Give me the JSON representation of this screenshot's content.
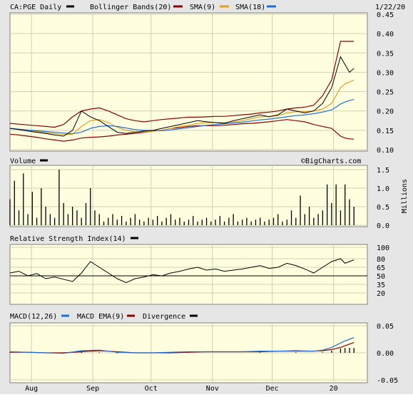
{
  "colors": {
    "frame_bg": "#e6e6e6",
    "panel_bg": "#ffffe0",
    "grid": "#cfcfb8",
    "price": "#000000",
    "bollinger": "#8b0000",
    "sma9": "#e0a020",
    "sma18": "#1f6fd8",
    "volume": "#000000",
    "rsi": "#000000",
    "macd": "#1f6fd8",
    "macd_ema": "#8b0000",
    "divergence": "#000000"
  },
  "header": {
    "date": "1/22/20",
    "legend": [
      {
        "label": "CA:PGE Daily",
        "color": "#000000"
      },
      {
        "label": "Bollinger Bands(20)",
        "color": "#8b0000"
      },
      {
        "label": "SMA(9)",
        "color": "#8b0000"
      },
      {
        "label": "SMA(18)",
        "color": "#e0a020"
      }
    ],
    "extra_swatch_color": "#1f6fd8"
  },
  "watermark": "©BigCharts.com",
  "chart_data": [
    {
      "type": "line",
      "panel": "price",
      "ticks": [
        0.1,
        0.15,
        0.2,
        0.25,
        0.3,
        0.35,
        0.4,
        0.45
      ],
      "tick_labels": [
        "0.10",
        "0.15",
        "0.20",
        "0.25",
        "0.30",
        "0.35",
        "0.40",
        "0.45"
      ],
      "ylim": [
        0.1,
        0.45
      ],
      "grid": true,
      "x": [
        0,
        4,
        8,
        12,
        16,
        20,
        24,
        28,
        32,
        36,
        40,
        44,
        48,
        52,
        56,
        60,
        64,
        68,
        72,
        76,
        80,
        84,
        88,
        92,
        96,
        100,
        104,
        108,
        112,
        116,
        120,
        124,
        128,
        132,
        136,
        140,
        144,
        146,
        148,
        150,
        152,
        154
      ],
      "close": [
        0.155,
        0.152,
        0.148,
        0.145,
        0.142,
        0.138,
        0.135,
        0.15,
        0.2,
        0.185,
        0.175,
        0.16,
        0.145,
        0.142,
        0.145,
        0.148,
        0.15,
        0.155,
        0.16,
        0.165,
        0.17,
        0.175,
        0.172,
        0.17,
        0.168,
        0.175,
        0.18,
        0.185,
        0.19,
        0.185,
        0.19,
        0.205,
        0.2,
        0.195,
        0.2,
        0.22,
        0.26,
        0.3,
        0.34,
        0.32,
        0.3,
        0.31
      ],
      "bb_upper": [
        0.168,
        0.166,
        0.164,
        0.162,
        0.16,
        0.158,
        0.165,
        0.185,
        0.2,
        0.205,
        0.208,
        0.2,
        0.19,
        0.18,
        0.175,
        0.172,
        0.175,
        0.178,
        0.18,
        0.182,
        0.184,
        0.184,
        0.185,
        0.186,
        0.186,
        0.188,
        0.19,
        0.192,
        0.195,
        0.197,
        0.2,
        0.205,
        0.208,
        0.21,
        0.215,
        0.24,
        0.28,
        0.33,
        0.38,
        0.38,
        0.38,
        0.38
      ],
      "bb_lower": [
        0.14,
        0.138,
        0.135,
        0.132,
        0.128,
        0.125,
        0.122,
        0.125,
        0.13,
        0.132,
        0.133,
        0.135,
        0.138,
        0.14,
        0.142,
        0.145,
        0.148,
        0.15,
        0.155,
        0.157,
        0.16,
        0.162,
        0.162,
        0.162,
        0.163,
        0.165,
        0.167,
        0.168,
        0.17,
        0.172,
        0.175,
        0.178,
        0.175,
        0.172,
        0.165,
        0.16,
        0.155,
        0.145,
        0.135,
        0.13,
        0.128,
        0.127
      ],
      "sma9": [
        0.155,
        0.152,
        0.15,
        0.147,
        0.144,
        0.141,
        0.139,
        0.14,
        0.16,
        0.175,
        0.178,
        0.17,
        0.158,
        0.15,
        0.146,
        0.146,
        0.148,
        0.15,
        0.155,
        0.16,
        0.163,
        0.168,
        0.17,
        0.17,
        0.17,
        0.172,
        0.175,
        0.18,
        0.185,
        0.186,
        0.188,
        0.195,
        0.198,
        0.198,
        0.2,
        0.205,
        0.22,
        0.24,
        0.26,
        0.27,
        0.275,
        0.28
      ],
      "sma18": [
        0.155,
        0.153,
        0.151,
        0.149,
        0.147,
        0.145,
        0.143,
        0.141,
        0.145,
        0.155,
        0.16,
        0.162,
        0.16,
        0.156,
        0.152,
        0.15,
        0.149,
        0.149,
        0.151,
        0.154,
        0.157,
        0.16,
        0.163,
        0.165,
        0.167,
        0.169,
        0.171,
        0.174,
        0.177,
        0.179,
        0.182,
        0.185,
        0.188,
        0.19,
        0.193,
        0.197,
        0.203,
        0.21,
        0.218,
        0.223,
        0.227,
        0.23
      ]
    },
    {
      "type": "bar",
      "panel": "volume",
      "ticks": [
        0.0,
        0.5,
        1.0,
        1.5
      ],
      "tick_labels": [
        "0.0",
        "0.5",
        "1.0",
        "1.5"
      ],
      "ylim": [
        0,
        1.5
      ],
      "ylabel": "Millions",
      "title": "Volume",
      "grid": true,
      "x": [
        0,
        2,
        4,
        6,
        8,
        10,
        12,
        14,
        16,
        18,
        20,
        22,
        24,
        26,
        28,
        30,
        32,
        34,
        36,
        38,
        40,
        42,
        44,
        46,
        48,
        50,
        52,
        54,
        56,
        58,
        60,
        62,
        64,
        66,
        68,
        70,
        72,
        74,
        76,
        78,
        80,
        82,
        84,
        86,
        88,
        90,
        92,
        94,
        96,
        98,
        100,
        102,
        104,
        106,
        108,
        110,
        112,
        114,
        116,
        118,
        120,
        122,
        124,
        126,
        128,
        130,
        132,
        134,
        136,
        138,
        140,
        142,
        144,
        146,
        148,
        150,
        152,
        154
      ],
      "values": [
        0.7,
        1.2,
        0.4,
        1.4,
        0.3,
        0.9,
        0.2,
        1.0,
        0.5,
        0.3,
        0.2,
        1.5,
        0.6,
        0.3,
        0.5,
        0.4,
        0.2,
        0.6,
        1.0,
        0.4,
        0.3,
        0.1,
        0.2,
        0.3,
        0.15,
        0.25,
        0.1,
        0.2,
        0.3,
        0.15,
        0.1,
        0.2,
        0.15,
        0.25,
        0.1,
        0.2,
        0.3,
        0.15,
        0.2,
        0.1,
        0.15,
        0.25,
        0.1,
        0.15,
        0.2,
        0.1,
        0.15,
        0.25,
        0.1,
        0.2,
        0.3,
        0.1,
        0.15,
        0.2,
        0.1,
        0.15,
        0.2,
        0.1,
        0.15,
        0.2,
        0.3,
        0.1,
        0.15,
        0.4,
        0.2,
        0.8,
        0.3,
        0.5,
        0.2,
        0.3,
        0.4,
        1.1,
        0.6,
        1.1,
        0.4,
        1.1,
        0.7,
        0.5
      ]
    },
    {
      "type": "line",
      "panel": "rsi",
      "title": "Relative Strength Index(14)",
      "ticks": [
        20,
        35,
        50,
        65,
        80,
        100
      ],
      "tick_labels": [
        "20",
        "35",
        "50",
        "65",
        "80",
        "100"
      ],
      "ylim": [
        0,
        100
      ],
      "reference_line": 50,
      "grid": true,
      "x": [
        0,
        4,
        8,
        12,
        16,
        20,
        24,
        28,
        32,
        36,
        40,
        44,
        48,
        52,
        56,
        60,
        64,
        68,
        72,
        76,
        80,
        84,
        88,
        92,
        96,
        100,
        104,
        108,
        112,
        116,
        120,
        124,
        128,
        132,
        136,
        140,
        144,
        148,
        150,
        152,
        154
      ],
      "values": [
        55,
        58,
        50,
        54,
        45,
        48,
        44,
        40,
        55,
        75,
        65,
        55,
        45,
        38,
        45,
        48,
        52,
        50,
        55,
        58,
        62,
        65,
        60,
        62,
        58,
        60,
        62,
        65,
        68,
        63,
        65,
        72,
        68,
        62,
        55,
        65,
        75,
        80,
        72,
        75,
        78
      ]
    },
    {
      "type": "line",
      "panel": "macd",
      "ticks": [
        -0.05,
        0.0,
        0.05
      ],
      "tick_labels": [
        "-0.05",
        "0.00",
        "0.05"
      ],
      "ylim": [
        -0.05,
        0.05
      ],
      "grid": true,
      "x": [
        0,
        8,
        16,
        24,
        32,
        40,
        48,
        56,
        64,
        72,
        80,
        88,
        96,
        104,
        112,
        120,
        128,
        136,
        140,
        144,
        148,
        150,
        152,
        154
      ],
      "macd": [
        0.002,
        0.001,
        0.0,
        -0.001,
        0.004,
        0.005,
        0.001,
        0.0,
        0.0,
        0.001,
        0.002,
        0.002,
        0.002,
        0.002,
        0.003,
        0.003,
        0.004,
        0.003,
        0.005,
        0.01,
        0.018,
        0.022,
        0.025,
        0.028
      ],
      "signal": [
        0.001,
        0.001,
        0.0,
        0.0,
        0.002,
        0.004,
        0.002,
        0.0,
        0.0,
        0.0,
        0.001,
        0.002,
        0.002,
        0.002,
        0.002,
        0.003,
        0.003,
        0.003,
        0.004,
        0.006,
        0.01,
        0.013,
        0.016,
        0.019
      ],
      "divergence": [
        0.001,
        0.0,
        0.0,
        -0.001,
        0.002,
        0.001,
        -0.001,
        0.0,
        0.0,
        0.001,
        0.001,
        0.0,
        0.0,
        0.0,
        0.001,
        0.0,
        0.001,
        0.0,
        0.001,
        0.004,
        0.008,
        0.009,
        0.009,
        0.009
      ]
    }
  ],
  "panels": {
    "volume": {
      "title": "Volume"
    },
    "rsi": {
      "title": "Relative Strength Index(14)"
    },
    "macd": {
      "legend": [
        {
          "label": "MACD(12,26)",
          "color": "#1f6fd8"
        },
        {
          "label": "MACD EMA(9)",
          "color": "#8b0000"
        },
        {
          "label": "Divergence",
          "color": "#000000"
        }
      ]
    }
  },
  "x_axis": {
    "labels": [
      {
        "text": "Aug",
        "x": 14
      },
      {
        "text": "Sep",
        "x": 54
      },
      {
        "text": "Oct",
        "x": 92
      },
      {
        "text": "Nov",
        "x": 132
      },
      {
        "text": "Dec",
        "x": 171
      },
      {
        "text": "20",
        "x": 211
      }
    ],
    "x_max": 233
  }
}
